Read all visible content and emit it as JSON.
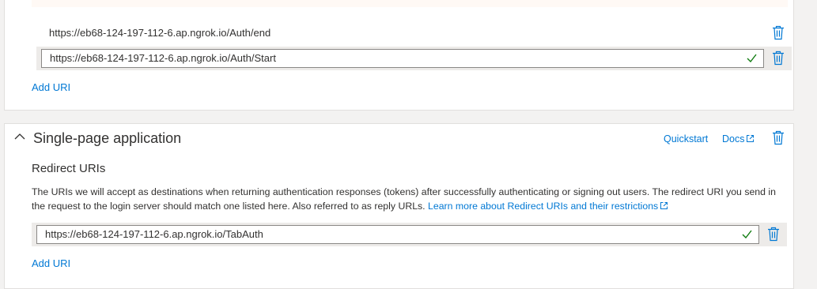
{
  "web": {
    "uris": [
      {
        "value": "https://eb68-124-197-112-6.ap.ngrok.io/Auth/end",
        "editing": false
      },
      {
        "value": "https://eb68-124-197-112-6.ap.ngrok.io/Auth/Start",
        "editing": true
      }
    ],
    "add_uri": "Add URI"
  },
  "spa": {
    "title": "Single-page application",
    "quickstart": "Quickstart",
    "docs": "Docs",
    "redirect_heading": "Redirect URIs",
    "description": "The URIs we will accept as destinations when returning authentication responses (tokens) after successfully authenticating or signing out users. The redirect URI you send in the request to the login server should match one listed here. Also referred to as reply URLs.",
    "learn_more": "Learn more about Redirect URIs and their restrictions",
    "uris": [
      {
        "value": "https://eb68-124-197-112-6.ap.ngrok.io/TabAuth",
        "editing": true
      }
    ],
    "add_uri": "Add URI"
  },
  "colors": {
    "accent": "#0078d4",
    "valid": "#107c10",
    "row_highlight": "#edebe9"
  }
}
